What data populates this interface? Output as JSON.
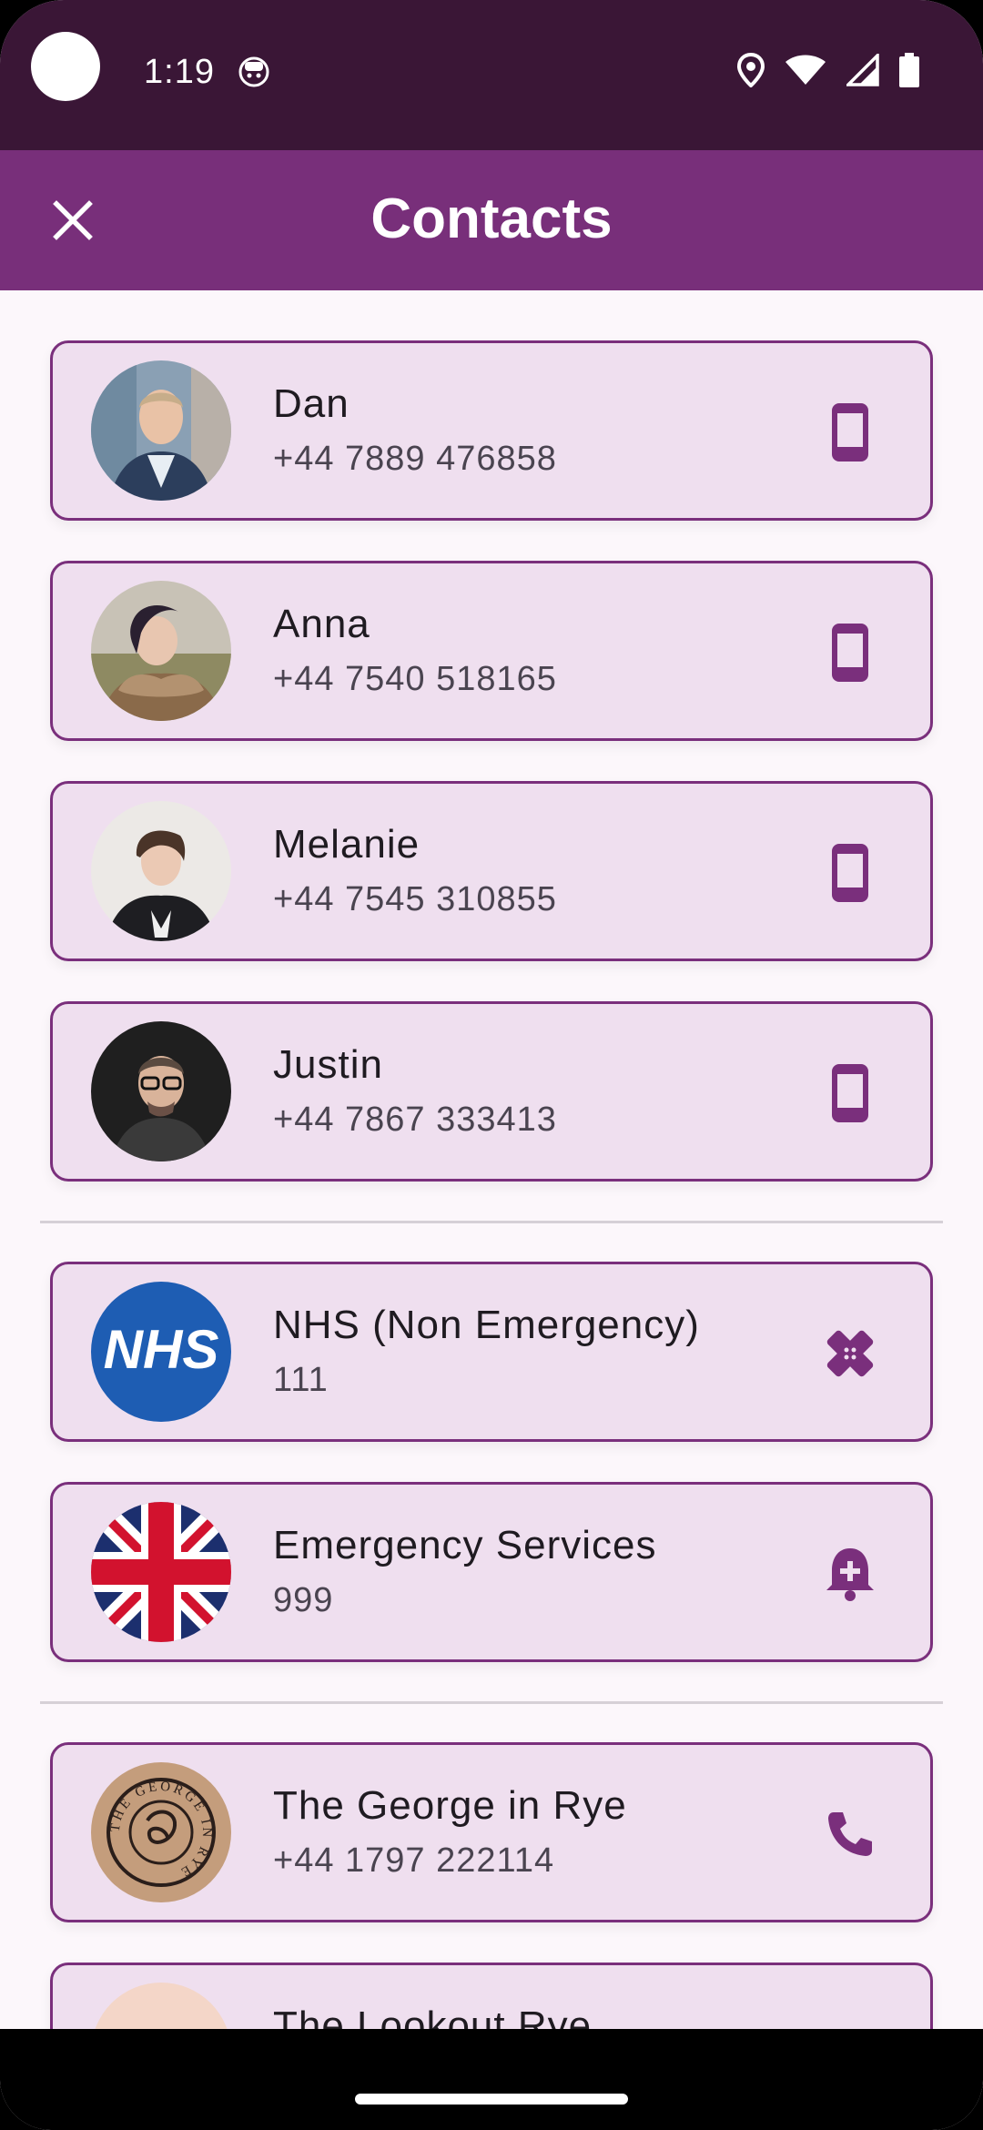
{
  "status_bar": {
    "time": "1:19",
    "icons": [
      "android-face-icon",
      "location-icon",
      "wifi-icon",
      "signal-icon",
      "battery-icon"
    ]
  },
  "app_bar": {
    "title": "Contacts",
    "close_icon": "close-icon"
  },
  "contacts": [
    {
      "name": "Dan",
      "phone": "+44 7889 476858",
      "action_icon": "mobile-phone-icon",
      "avatar": "photo"
    },
    {
      "name": "Anna",
      "phone": "+44 7540 518165",
      "action_icon": "mobile-phone-icon",
      "avatar": "photo"
    },
    {
      "name": "Melanie",
      "phone": "+44 7545 310855",
      "action_icon": "mobile-phone-icon",
      "avatar": "photo"
    },
    {
      "name": "Justin",
      "phone": "+44 7867 333413",
      "action_icon": "mobile-phone-icon",
      "avatar": "photo"
    },
    {
      "name": "NHS (Non Emergency)",
      "phone": "111",
      "action_icon": "bandage-icon",
      "avatar": "nhs-logo",
      "logo_text": "NHS"
    },
    {
      "name": "Emergency Services",
      "phone": "999",
      "action_icon": "medical-bell-icon",
      "avatar": "union-jack-flag"
    },
    {
      "name": "The George in Rye",
      "phone": "+44 1797 222114",
      "action_icon": "phone-icon",
      "avatar": "george-logo",
      "logo_text": "THE GEORGE IN RYE"
    },
    {
      "name": "The Lookout Rye",
      "phone": "",
      "action_icon": "",
      "avatar": "partial"
    }
  ],
  "colors": {
    "status_bar": "#3a1636",
    "app_bar": "#782f7a",
    "card_bg": "#efdfef",
    "card_border": "#7a2f7c",
    "icon_accent": "#7a2f7c",
    "nhs_blue": "#1e5db3"
  }
}
